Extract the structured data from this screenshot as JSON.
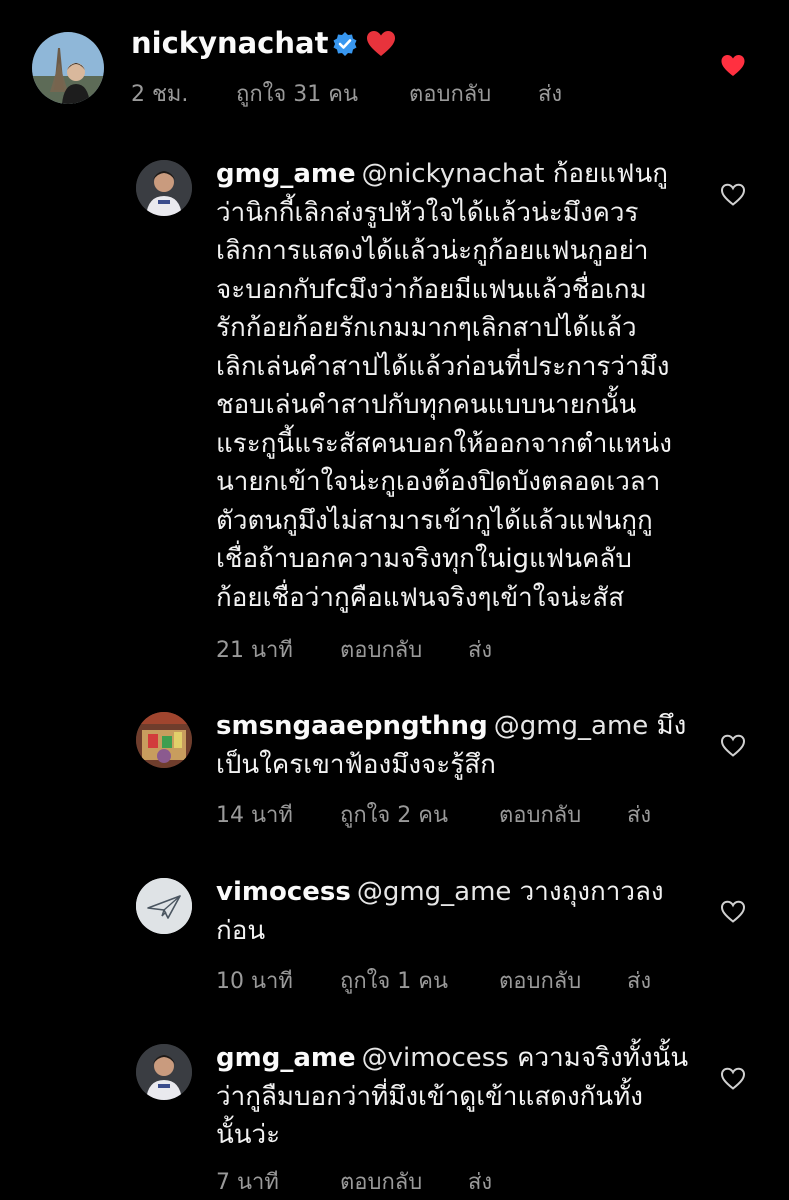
{
  "colors": {
    "background": "#000000",
    "text": "#f2f2f2",
    "meta": "#9a9a9a",
    "like_active": "#ff3040",
    "verified": "#3897f0"
  },
  "top_comment": {
    "username": "nickynachat",
    "verified_icon": "verified-badge-icon",
    "emoji": "red-heart-emoji",
    "time": "2 ชม.",
    "likes": "ถูกใจ 31 คน",
    "reply": "ตอบกลับ",
    "send": "ส่ง",
    "liked": true
  },
  "comments": [
    {
      "username": "gmg_ame",
      "mention": "@nickynachat",
      "text_lines": [
        "ก้อยแฟนกู",
        "ว่านิกกี้เลิกส่งรูปหัวใจได้แล้วน่ะมึงควร",
        "เลิกการแสดงได้แล้วน่ะกูก้อยแฟนกูอย่า",
        "จะบอกกับfcมึงว่าก้อยมีแฟนแล้วชื่อเกม",
        "รักก้อยก้อยรักเกมมากๆเลิกสาปได้แล้ว",
        "เลิกเล่นคำสาปได้แล้วก่อนที่ประการว่ามึง",
        "ชอบเล่นคำสาปกับทุกคนแบบนายกนั้น",
        "แระกูนี้แระสัสคนบอกให้ออกจากตำแหน่ง",
        "นายกเข้าใจน่ะกูเองต้องปิดบังตลอดเวลา",
        "ตัวตนกูมึงไม่สามารเข้ากูได้แล้วแฟนกูกู",
        "เชื่อถ้าบอกความจริงทุกในigแฟนคลับ",
        "ก้อยเชื่อว่ากูคือแฟนจริงๆเข้าใจน่ะสัส"
      ],
      "time": "21 นาที",
      "likes": "",
      "reply": "ตอบกลับ",
      "send": "ส่ง"
    },
    {
      "username": "smsngaaepngthng",
      "mention": "@gmg_ame",
      "text_lines": [
        "มึง",
        "เป็นใครเขาฟ้องมึงจะรู้สึก"
      ],
      "time": "14 นาที",
      "likes": "ถูกใจ 2 คน",
      "reply": "ตอบกลับ",
      "send": "ส่ง"
    },
    {
      "username": "vimocess",
      "mention": "@gmg_ame",
      "text_lines": [
        "วางถุงกาวลง",
        "ก่อน"
      ],
      "time": "10 นาที",
      "likes": "ถูกใจ 1 คน",
      "reply": "ตอบกลับ",
      "send": "ส่ง"
    },
    {
      "username": "gmg_ame",
      "mention": "@vimocess",
      "text_lines": [
        "ความจริงทั้งนั้น",
        "ว่ากูลืมบอกว่าที่มึงเข้าดูเข้าแสดงกันทั้ง",
        "นั้นว่ะ"
      ],
      "time": "7 นาที",
      "likes": "",
      "reply": "ตอบกลับ",
      "send": "ส่ง"
    }
  ]
}
